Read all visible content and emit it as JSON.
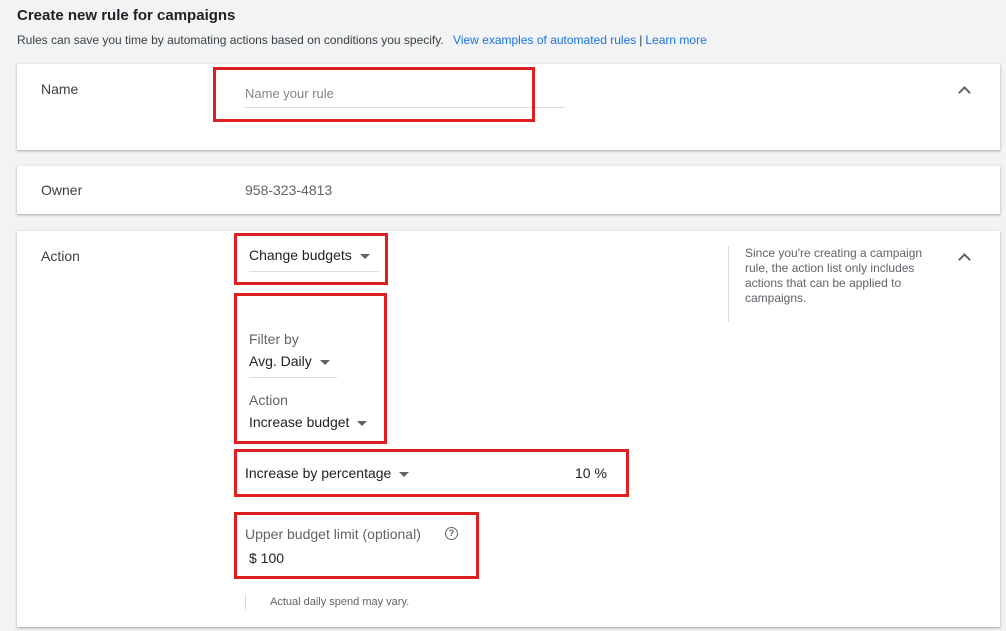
{
  "header": {
    "title": "Create new rule for campaigns",
    "subtitle": "Rules can save you time by automating actions based on conditions you specify.",
    "examples_link": "View examples of automated rules",
    "separator": "|",
    "learn_more_link": "Learn more"
  },
  "name_section": {
    "label": "Name",
    "placeholder": "Name your rule",
    "value": ""
  },
  "owner_section": {
    "label": "Owner",
    "value": "958-323-4813"
  },
  "action_section": {
    "label": "Action",
    "action_type": "Change budgets",
    "filter_label": "Filter by",
    "filter_value": "Avg. Daily",
    "action_label": "Action",
    "action_value": "Increase budget",
    "increase_method": "Increase by percentage",
    "percentage_value": "10 %",
    "upper_limit_label": "Upper budget limit (optional)",
    "upper_limit_value": "$ 100",
    "help_icon": "?",
    "note": "Actual daily spend may vary.",
    "help_text": "Since you're creating a campaign rule, the action list only includes actions that can be applied to campaigns."
  },
  "icons": {
    "collapse": "chevron-up-icon",
    "dropdown": "caret-down-icon",
    "help": "help-circle-icon"
  },
  "colors": {
    "highlight_box": "#e02020",
    "link": "#1a73e8",
    "background": "#f1f3f4"
  }
}
